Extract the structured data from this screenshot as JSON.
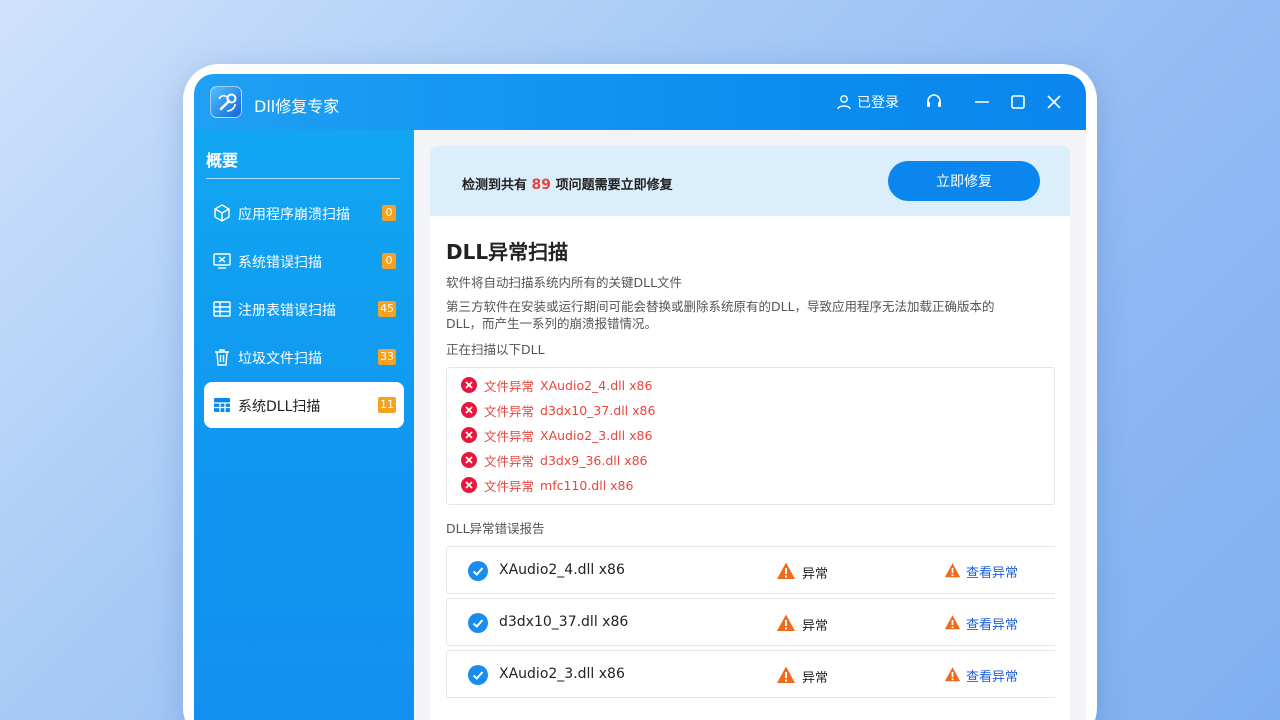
{
  "app": {
    "title": "Dll修复专家",
    "login_label": "已登录"
  },
  "sidebar": {
    "title": "概要",
    "items": [
      {
        "label": "应用程序崩溃扫描",
        "count": "0",
        "icon": "cube-icon"
      },
      {
        "label": "系统错误扫描",
        "count": "0",
        "icon": "monitor-error-icon"
      },
      {
        "label": "注册表错误扫描",
        "count": "45",
        "icon": "table-icon"
      },
      {
        "label": "垃圾文件扫描",
        "count": "33",
        "icon": "trash-icon"
      },
      {
        "label": "系统DLL扫描",
        "count": "11",
        "icon": "grid-icon",
        "active": true
      }
    ]
  },
  "banner": {
    "prefix": "检测到共有",
    "count": "89",
    "suffix": "项问题需要立即修复",
    "fix_button": "立即修复"
  },
  "panel": {
    "title": "DLL异常扫描",
    "desc1": "软件将自动扫描系统内所有的关键DLL文件",
    "desc2": "第三方软件在安装或运行期间可能会替换或删除系统原有的DLL，导致应用程序无法加载正确版本的DLL，而产生一系列的崩溃报错情况。",
    "scanning_label": "正在扫描以下DLL",
    "scan_items": [
      {
        "status": "文件异常",
        "file": "XAudio2_4.dll x86"
      },
      {
        "status": "文件异常",
        "file": "d3dx10_37.dll x86"
      },
      {
        "status": "文件异常",
        "file": "XAudio2_3.dll x86"
      },
      {
        "status": "文件异常",
        "file": "d3dx9_36.dll x86"
      },
      {
        "status": "文件异常",
        "file": "mfc110.dll x86"
      }
    ],
    "report_label": "DLL异常错误报告",
    "report_rows": [
      {
        "name": "XAudio2_4.dll x86",
        "status": "异常",
        "action": "查看异常"
      },
      {
        "name": "d3dx10_37.dll x86",
        "status": "异常",
        "action": "查看异常"
      },
      {
        "name": "XAudio2_3.dll x86",
        "status": "异常",
        "action": "查看异常"
      }
    ]
  },
  "colors": {
    "accent": "#0a86ee",
    "error": "#e8453c",
    "warning": "#f06a1a",
    "badge": "#f4a21f",
    "link": "#1a5ed6"
  }
}
